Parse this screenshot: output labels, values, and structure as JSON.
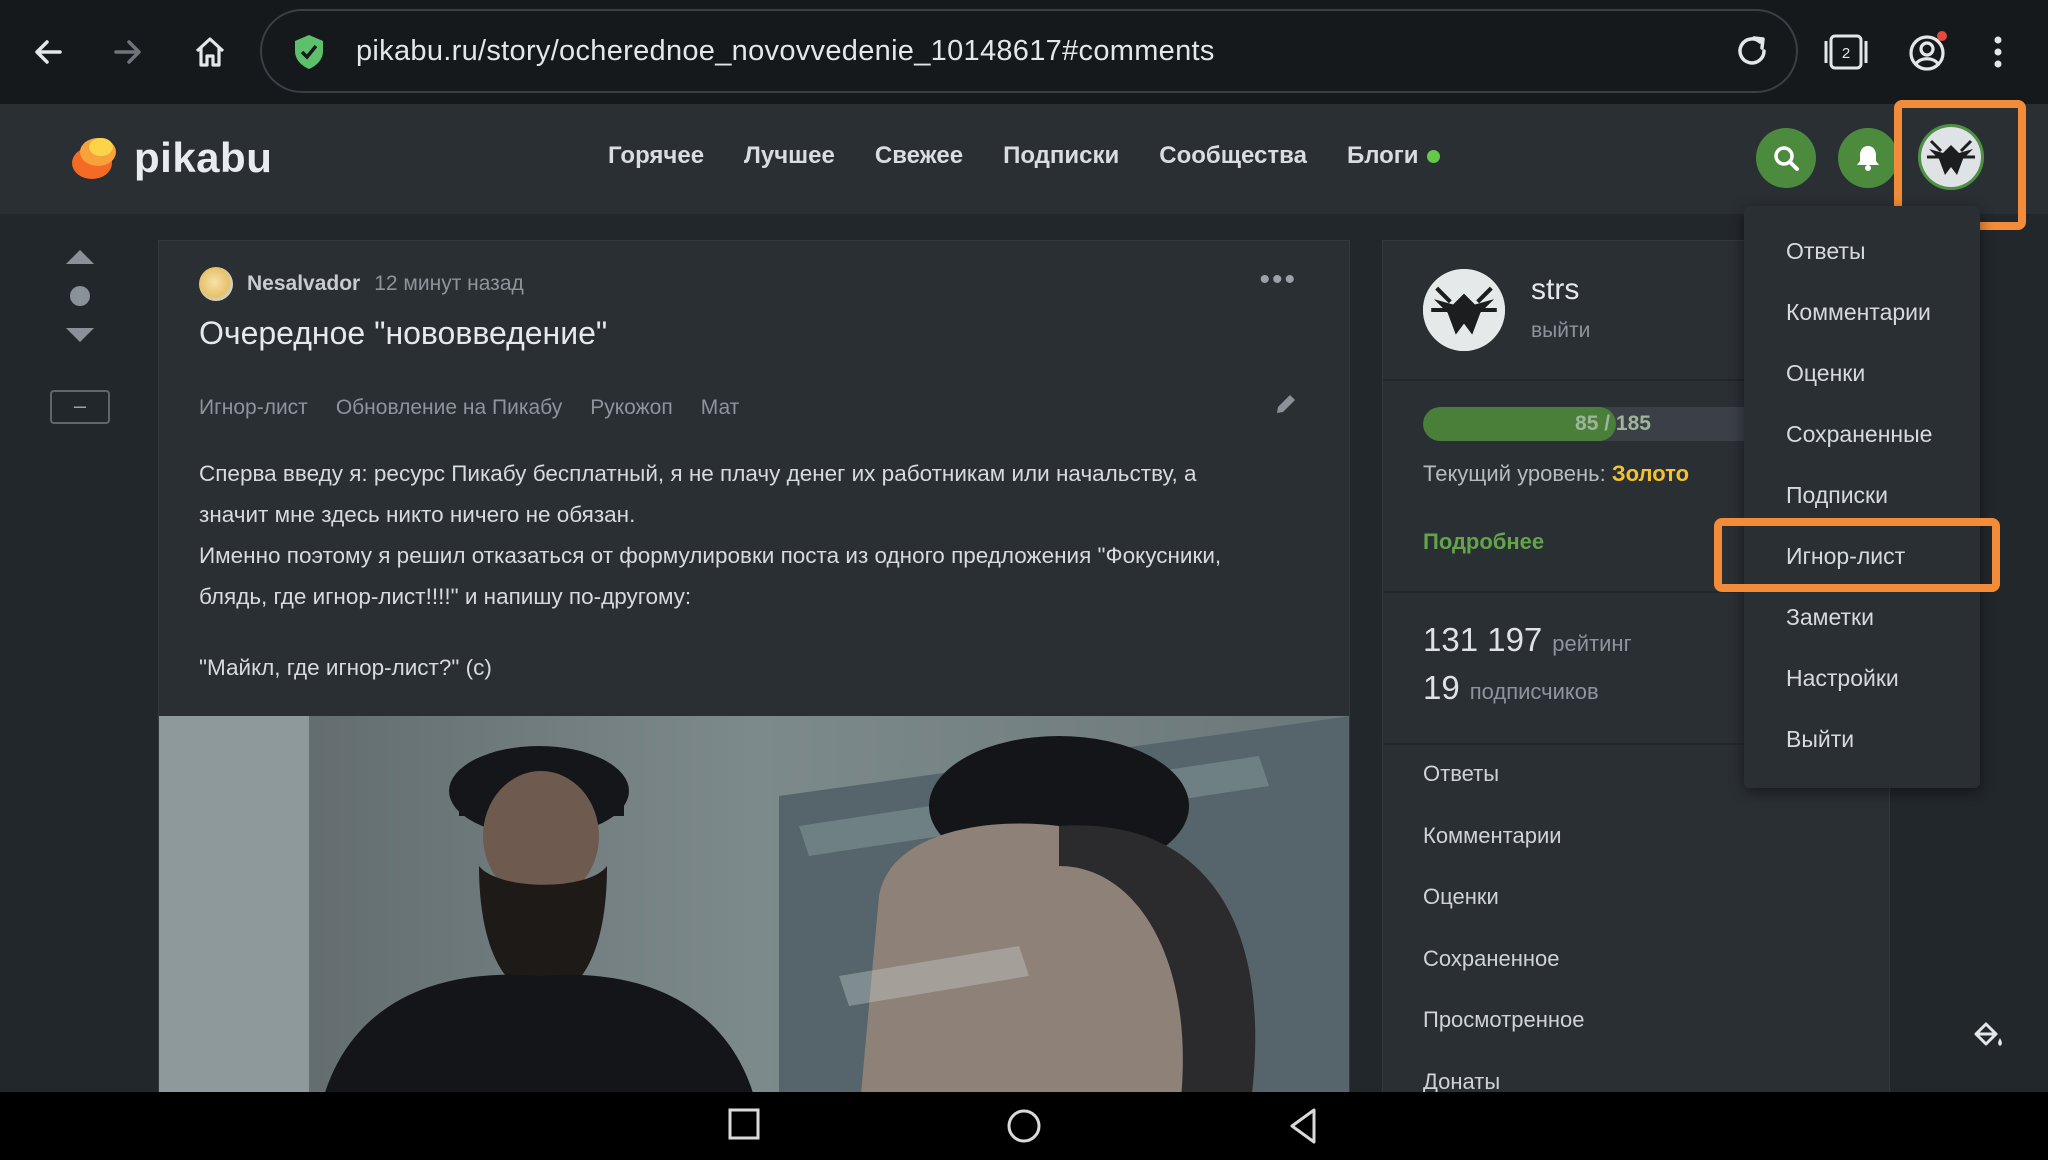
{
  "browser": {
    "url": "pikabu.ru/story/ocherednoe_novovvedenie_10148617#comments",
    "tabs_count": "2"
  },
  "site": {
    "logo_text": "pikabu",
    "nav": [
      "Горячее",
      "Лучшее",
      "Свежее",
      "Подписки",
      "Сообщества",
      "Блоги"
    ]
  },
  "post": {
    "author": "Nesalvador",
    "time": "12 минут назад",
    "title": "Очередное \"нововведение\"",
    "tags": [
      "Игнор-лист",
      "Обновление на Пикабу",
      "Рукожоп",
      "Мат"
    ],
    "body": [
      "Сперва введу я: ресурс Пикабу бесплатный, я не плачу денег их работникам или начальству, а",
      "значит мне здесь никто ничего не обязан.",
      "Именно поэтому я решил отказаться от формулировки поста из одного предложения \"Фокусники,",
      "блядь, где игнор-лист!!!!\" и напишу по-другому:"
    ],
    "quote": "\"Майкл, где игнор-лист?\" (с)"
  },
  "profile": {
    "username": "strs",
    "logout": "выйти",
    "progress_text": "85 / 185",
    "progress_fraction": 0.46,
    "level_label": "Текущий уровень:",
    "level_value": "Золото",
    "more": "Подробнее",
    "rating_num": "131 197",
    "rating_label": "рейтинг",
    "subs_num": "19",
    "subs_label": "подписчиков",
    "links": [
      "Ответы",
      "Комментарии",
      "Оценки",
      "Сохраненное",
      "Просмотренное",
      "Донаты"
    ]
  },
  "dropdown": {
    "items": [
      "Ответы",
      "Комментарии",
      "Оценки",
      "Сохраненные",
      "Подписки",
      "Игнор-лист",
      "Заметки",
      "Настройки",
      "Выйти"
    ]
  },
  "colors": {
    "accent_green": "#4c8b3d",
    "highlight": "#f28c38",
    "gold": "#f2c230"
  }
}
